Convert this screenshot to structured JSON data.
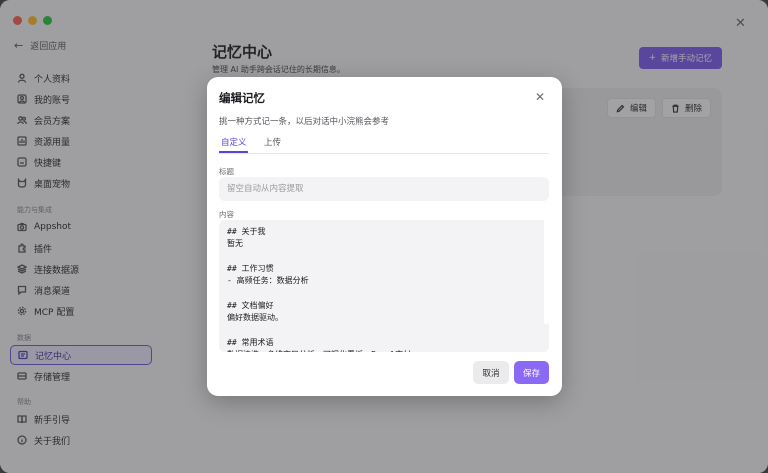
{
  "sidebar": {
    "back_label": "返回应用",
    "items": [
      {
        "label": "个人资料"
      },
      {
        "label": "我的账号"
      },
      {
        "label": "会员方案"
      },
      {
        "label": "资源用量"
      },
      {
        "label": "快捷键"
      },
      {
        "label": "桌面宠物"
      },
      {
        "label": "Appshot"
      },
      {
        "label": "插件"
      },
      {
        "label": "连接数据源"
      },
      {
        "label": "消息渠道"
      },
      {
        "label": "MCP 配置"
      },
      {
        "label": "记忆中心"
      },
      {
        "label": "存储管理"
      },
      {
        "label": "新手引导"
      },
      {
        "label": "关于我们"
      }
    ],
    "sections": [
      "能力与集成",
      "数据",
      "帮助"
    ]
  },
  "main": {
    "title": "记忆中心",
    "subtitle": "管理 AI 助手跨会话记住的长期信息。",
    "new_button": "新增手动记忆",
    "edit_label": "编辑",
    "delete_label": "删除"
  },
  "modal": {
    "title": "编辑记忆",
    "description": "挑一种方式记一条，以后对话中小浣熊会参考",
    "tabs": [
      "自定义",
      "上传"
    ],
    "active_tab": "自定义",
    "title_field_label": "标题",
    "title_placeholder": "留空自动从内容提取",
    "title_value": "",
    "content_label": "内容",
    "content_value": "## 关于我\n暂无\n\n## 工作习惯\n- 高频任务：数据分析\n\n## 文档偏好\n偏好数据驱动。\n\n## 常用术语\n数据清洗、多维交叉分析、可视化看板、Excel交付",
    "cancel_label": "取消",
    "save_label": "保存"
  },
  "colors": {
    "accent": "#7c5cf0",
    "save": "#8a6af5",
    "active_nav_border": "#6e5ae0"
  }
}
